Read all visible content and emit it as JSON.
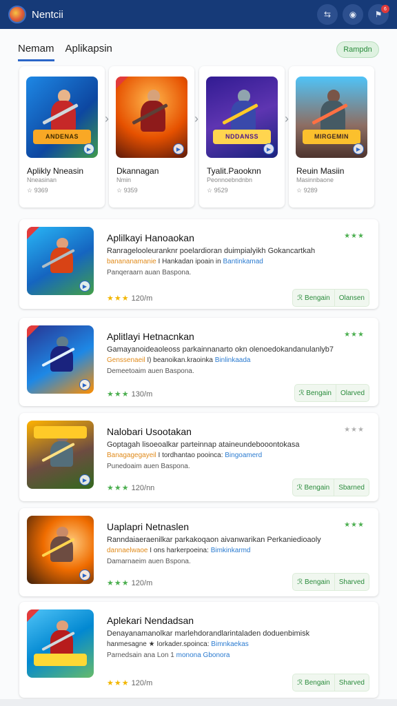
{
  "topbar": {
    "title": "Nentcii",
    "icons": [
      "app-logo-icon",
      "swap-arrows-icon",
      "user-icon",
      "notification-icon"
    ],
    "notification_badge": "6",
    "btn1_glyph": "⇆",
    "btn2_glyph": "◉",
    "btn3_glyph": "⚑"
  },
  "tabs": [
    {
      "label": "Nemam",
      "active": true
    },
    {
      "label": "Aplikapsin",
      "active": false
    }
  ],
  "action_pill": "Rampdn",
  "featured": [
    {
      "name": "Aplikly Nneasin",
      "dev": "Nneasinan",
      "count": "☆ 9369",
      "banner": "ANDENAS"
    },
    {
      "name": "Dkannagan",
      "dev": "Nmin",
      "count": "☆ 9359",
      "banner": ""
    },
    {
      "name": "Tyalit.Paooknn",
      "dev": "Peonnoebndnbn",
      "count": "☆ 9529",
      "banner": "NDDANSS"
    },
    {
      "name": "Reuin Masiin",
      "dev": "Masinnbaone",
      "count": "☆ 9289",
      "banner": "MIRGEMIN"
    }
  ],
  "items": [
    {
      "title": "Aplilkayi Hanoaokan",
      "desc1": "Ranragelooleuranknr poelardioran duimpialyikh Gokancartkah",
      "desc2_orange": "banananamanie",
      "desc2_dark": "I Hankadan ipoain in",
      "desc2_blue": "Bantinkamad",
      "desc3": "Panqeraarn auan Baspona.",
      "stars_top": "★★★",
      "stars": "★★★",
      "rating_text": "120/m",
      "btn1": "ℛ Bengain",
      "btn2": "Olansen"
    },
    {
      "title": "Aplitlayi Hetnacnkan",
      "desc1": "Gamayanoideaoleoss parkainnanarto okn olenoedokandanulanlyb7",
      "desc2_orange": "Genssenaeil",
      "desc2_dark": "I) beanoikan.kraoinka",
      "desc2_blue": "Binlinkaada",
      "desc3": "Demeetoaim auen Baspona.",
      "stars_top": "★★★",
      "stars": "★★★",
      "rating_text": "130/m",
      "btn1": "ℛ Bengain",
      "btn2": "Olarved"
    },
    {
      "title": "Nalobari Usootakan",
      "desc1": "Goptagah lisoeoalkar parteinnap ataineundebooontokasa",
      "desc2_orange": "Banagagegayeil",
      "desc2_dark": "I tordhantao pooinca:",
      "desc2_blue": "Bingoamerd",
      "desc3": "Punedoaim auen Baspona.",
      "stars_top": "★★★",
      "stars": "★★★",
      "rating_text": "120/nn",
      "btn1": "ℛ Bengain",
      "btn2": "Sbarned"
    },
    {
      "title": "Uaplapri Netnaslen",
      "desc1": "Ranndaiaeraenilkar parkakoqaon aivanwarikan Perkaniedioaoly",
      "desc2_orange": "dannaelwaoe",
      "desc2_dark": "I ons harkerpoeina:",
      "desc2_blue": "Bimkinkarmd",
      "desc3": "Damarnaeim auen Bspona.",
      "stars_top": "★★★",
      "stars": "★★★",
      "rating_text": "120/m",
      "btn1": "ℛ Bengain",
      "btn2": "Sharved"
    },
    {
      "title": "Aplekari Nendadsan",
      "desc1": "Denayanamanolkar marlehdorandlarintaladen doduenbimisk",
      "desc2_orange": "",
      "desc2_dark": "hanmesagne ★ Iorkader.spoinca:",
      "desc2_blue": "Bimnkaekas",
      "desc3": "Parnedsain ana Lon 1",
      "desc3_blue": "monona Gbonora",
      "stars_top": "",
      "stars": "★★★",
      "rating_text": "120/m",
      "btn1": "ℛ Bengain",
      "btn2": "Sharved"
    }
  ],
  "colors": {
    "topbar": "#163a78",
    "accent_blue": "#2b66c8",
    "accent_green": "#2a8b3c",
    "star_gold": "#f2b600",
    "star_green": "#4caf50"
  }
}
